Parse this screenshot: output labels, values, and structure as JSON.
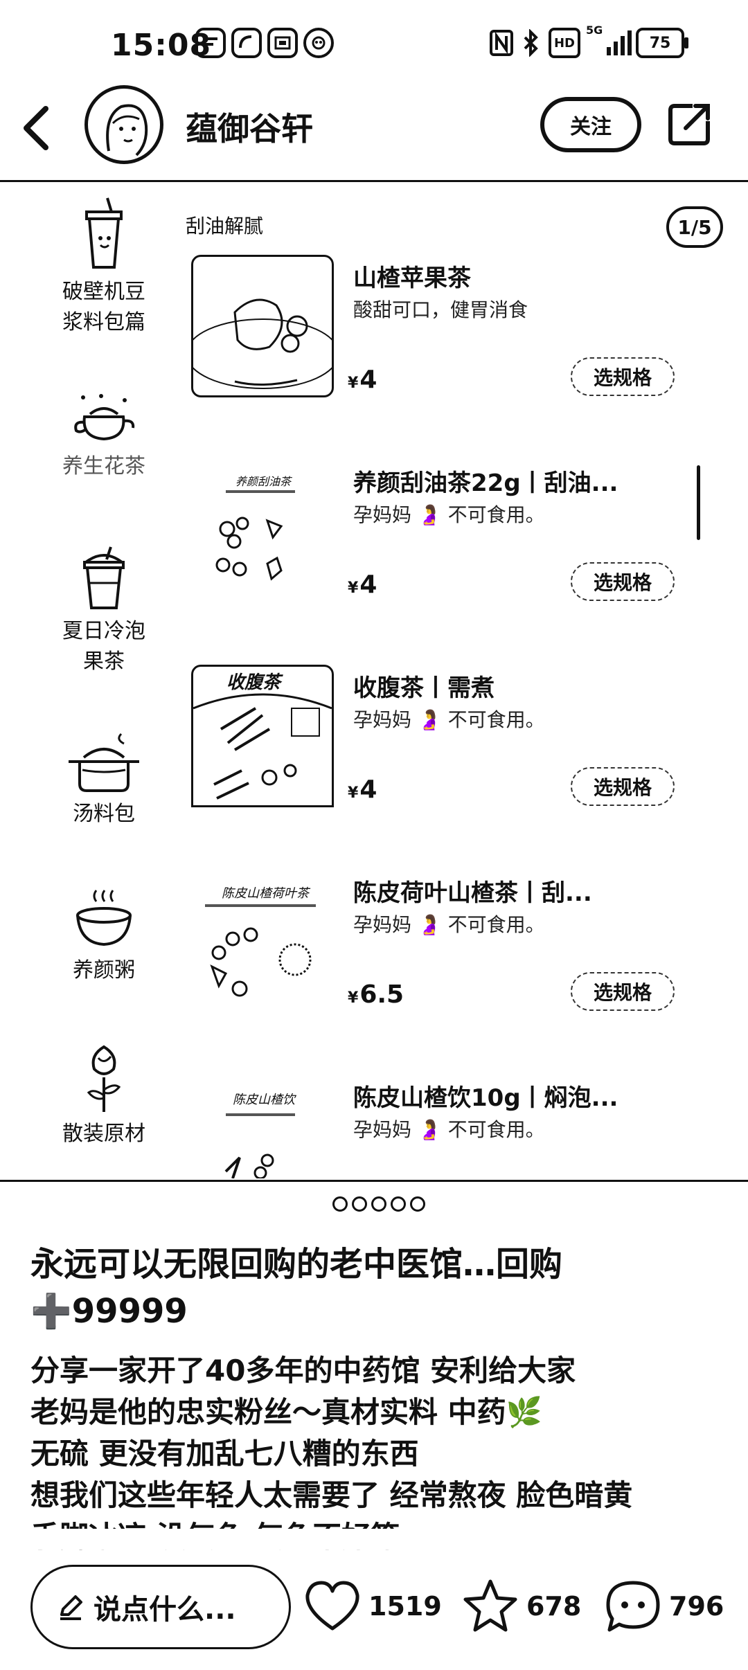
{
  "status_bar": {
    "time": "15:08",
    "battery": "75",
    "hd": "HD",
    "network": "5G"
  },
  "header": {
    "shop_name": "蕴御谷轩",
    "follow_label": "关注"
  },
  "sidebar": {
    "items": [
      {
        "label": "破壁机豆\n浆料包篇",
        "icon": "cup-icon"
      },
      {
        "label": "养生花茶",
        "icon": "teapot-icon"
      },
      {
        "label": "夏日冷泡\n果茶",
        "icon": "cold-drink-icon"
      },
      {
        "label": "汤料包",
        "icon": "pot-icon"
      },
      {
        "label": "养颜粥",
        "icon": "bowl-icon"
      },
      {
        "label": "散装原材",
        "icon": "rose-icon"
      }
    ]
  },
  "products": {
    "category": "刮油解腻",
    "page_indicator": "1/5",
    "currency": "¥",
    "spec_label": "选规格",
    "items": [
      {
        "name": "山楂苹果茶",
        "desc": "酸甜可口，健胃消食",
        "price": "4"
      },
      {
        "name": "养颜刮油茶22g丨刮油...",
        "desc": "孕妈妈 🤰 不可食用。",
        "price": "4",
        "image_text": "养颜刮油茶"
      },
      {
        "name": "收腹茶丨需煮",
        "desc": "孕妈妈 🤰 不可食用。",
        "price": "4",
        "image_text": "收腹茶"
      },
      {
        "name": "陈皮荷叶山楂茶丨刮...",
        "desc": "孕妈妈 🤰 不可食用。",
        "price": "6.5",
        "image_text": "陈皮山楂荷叶茶"
      },
      {
        "name": "陈皮山楂饮10g丨焖泡...",
        "desc": "孕妈妈 🤰 不可食用。",
        "image_text": "陈皮山楂饮"
      }
    ]
  },
  "post": {
    "title_line1": "永远可以无限回购的老中医馆…回购",
    "title_line2": "➕99999",
    "body_lines": [
      "分享一家开了40多年的中药馆 安利给大家",
      "老妈是他的忠实粉丝～真材实料 中药🌿",
      "无硫 更没有加乱七八糟的东西",
      "想我们这些年轻人太需要了 经常熬夜 脸色暗黄",
      "手脚冰凉 没气色 气色不好等"
    ]
  },
  "bottom_bar": {
    "comment_placeholder": "说点什么...",
    "likes": "1519",
    "collects": "678",
    "comments": "796"
  }
}
